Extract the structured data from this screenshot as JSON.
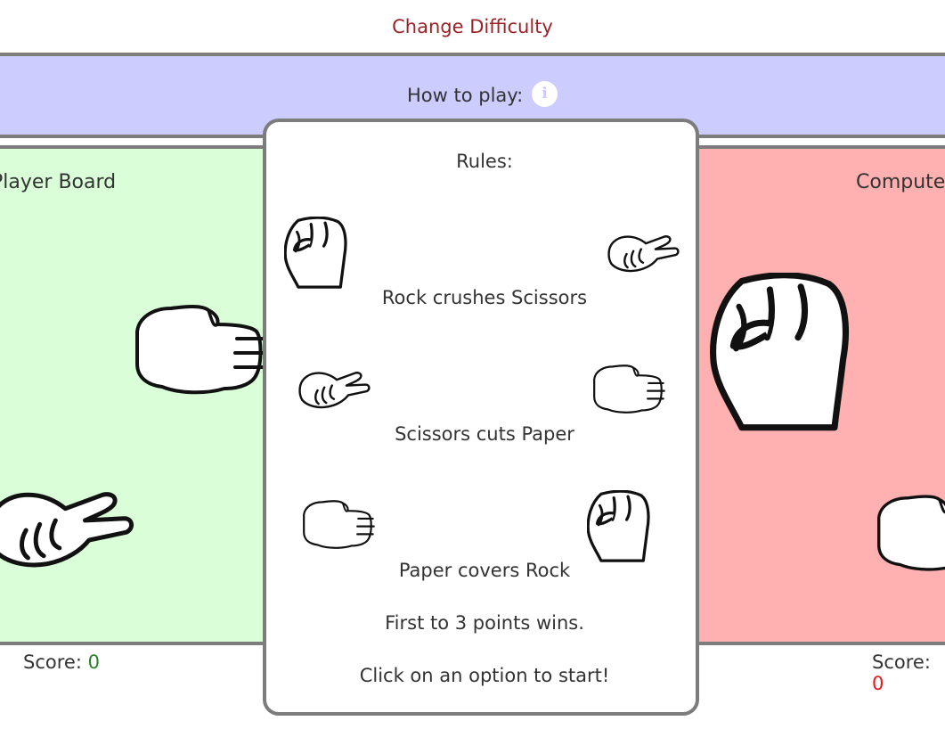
{
  "header": {
    "change_difficulty": "Change Difficulty"
  },
  "howto": {
    "label": "How to play:",
    "info_icon": "info-icon"
  },
  "player": {
    "title": "Player Board",
    "score_label": "Score:",
    "score_value": "0"
  },
  "computer": {
    "title": "Computer",
    "score_label": "Score:",
    "score_value": "0"
  },
  "modal": {
    "title": "Rules:",
    "rules": [
      {
        "text": "Rock crushes Scissors",
        "winner_icon": "rock-icon",
        "loser_icon": "scissors-icon"
      },
      {
        "text": "Scissors cuts Paper",
        "winner_icon": "scissors-icon",
        "loser_icon": "paper-icon"
      },
      {
        "text": "Paper covers Rock",
        "winner_icon": "paper-icon",
        "loser_icon": "rock-icon"
      }
    ],
    "points_text": "First to 3 points wins.",
    "start_text": "Click on an option to start!"
  },
  "colors": {
    "accent_red": "#9b2226",
    "howto_bar": "#ccccff",
    "player_board": "#d9fed8",
    "computer_board": "#ffb0b0",
    "border": "#7c7c7c",
    "player_score": "#2a7f2a",
    "computer_score": "#e01b1b"
  }
}
